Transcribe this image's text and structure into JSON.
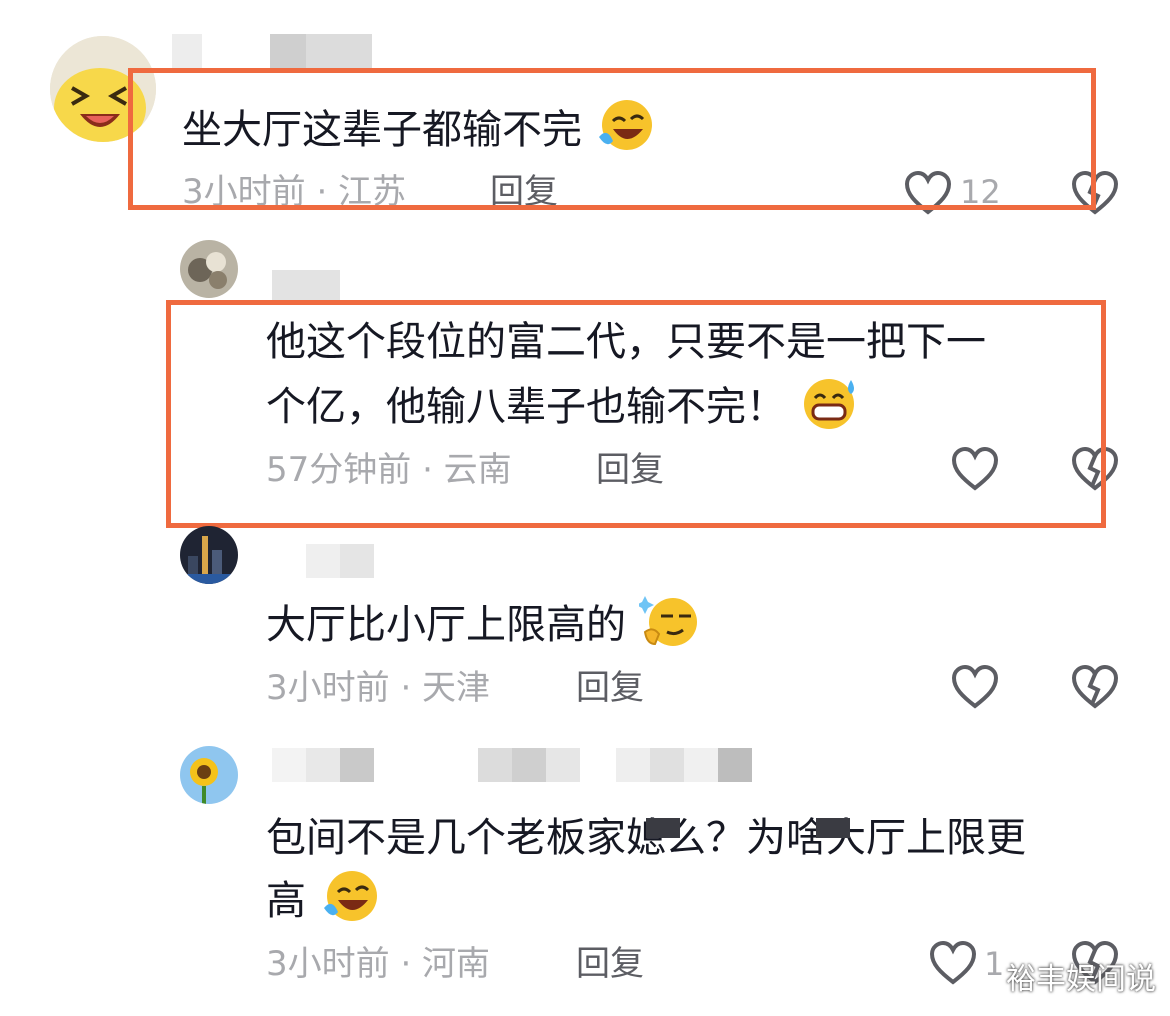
{
  "comments": [
    {
      "text": "坐大厅这辈子都输不完",
      "time": "3小时前 · 江苏",
      "reply": "回复",
      "likes": "12"
    },
    {
      "text_line1": "他这个段位的富二代，只要不是一把下一",
      "text_line2": "个亿，他输八辈子也输不完！",
      "time": "57分钟前 · 云南",
      "reply": "回复"
    },
    {
      "text": "大厅比小厅上限高的",
      "time": "3小时前 · 天津",
      "reply": "回复"
    },
    {
      "text_line1": "包间不是几个老板家媳么？为啥大厅上限更",
      "text_line2": "高",
      "time": "3小时前 · 河南",
      "reply": "回复",
      "likes": "1"
    }
  ],
  "icons": {
    "like": "heart-outline-icon",
    "dislike": "broken-heart-icon"
  },
  "colors": {
    "highlight": "#ef6a3f",
    "meta_text": "#a8a9ad",
    "icon_gray": "#5c5d63"
  },
  "watermark": "裕丰娱间说"
}
